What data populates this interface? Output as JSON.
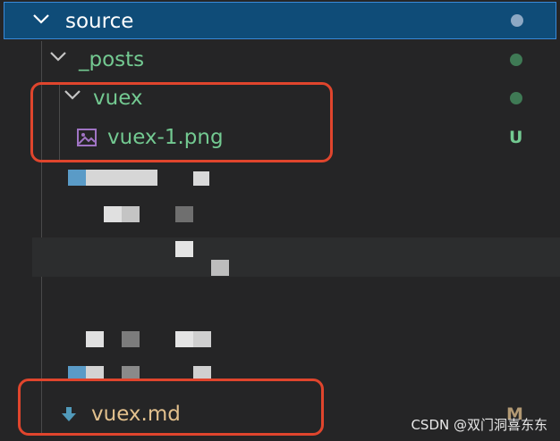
{
  "tree": {
    "root": {
      "label": "source"
    },
    "posts": {
      "label": "_posts"
    },
    "vuex_folder": {
      "label": "vuex"
    },
    "png_file": {
      "label": "vuex-1.png",
      "status": "U"
    },
    "md_file": {
      "label": "vuex.md",
      "status": "M"
    }
  },
  "watermark": "CSDN @双门洞喜东东",
  "colors": {
    "untracked": "#73c991",
    "modified": "#e2c08d",
    "selection": "#0f4c78",
    "highlight_box": "#e0452d"
  }
}
